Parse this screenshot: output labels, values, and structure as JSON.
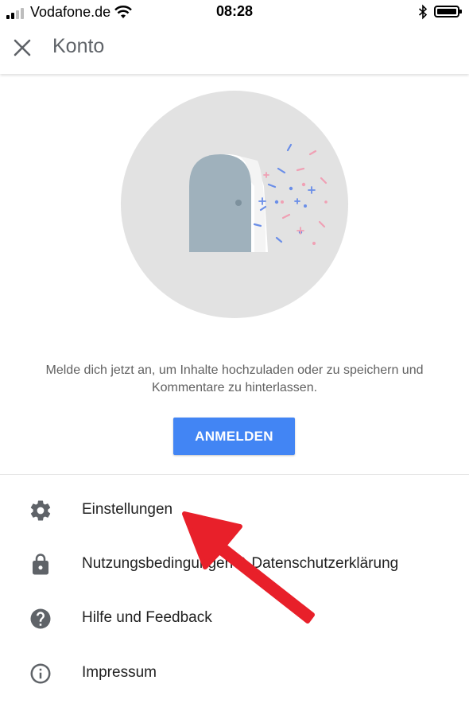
{
  "status_bar": {
    "carrier": "Vodafone.de",
    "time": "08:28"
  },
  "app_bar": {
    "title": "Konto",
    "close_icon": "close-icon"
  },
  "prompt": {
    "text": "Melde dich jetzt an, um Inhalte hochzuladen oder zu speichern und Kommentare zu hinterlassen."
  },
  "signin_button": {
    "label": "ANMELDEN",
    "color": "#4285f4"
  },
  "menu": [
    {
      "label": "Einstellungen",
      "icon": "gear-icon"
    },
    {
      "label": "Nutzungsbedingungen & Datenschutzerklärung",
      "icon": "lock-icon"
    },
    {
      "label": "Hilfe und Feedback",
      "icon": "help-icon"
    },
    {
      "label": "Impressum",
      "icon": "info-icon"
    }
  ],
  "annotation": {
    "color": "#e8202a"
  }
}
